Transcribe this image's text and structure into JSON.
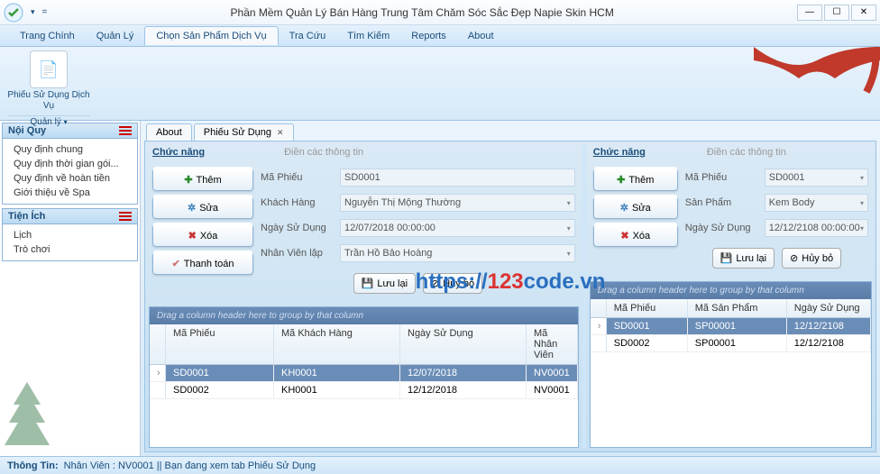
{
  "window": {
    "title": "Phần Mềm Quản Lý Bán Hàng Trung Tâm Chăm Sóc Sắc Đẹp Napie Skin HCM"
  },
  "menu": {
    "items": [
      "Trang Chính",
      "Quản Lý",
      "Chọn Sản Phẩm Dịch Vụ",
      "Tra Cứu",
      "Tìm Kiếm",
      "Reports",
      "About"
    ],
    "active_index": 2
  },
  "ribbon": {
    "button_label": "Phiếu Sử Dụng Dịch Vụ",
    "group_label": "Quản lý"
  },
  "sidebar": {
    "panel1": {
      "title": "Nội Quy",
      "items": [
        "Quy định chung",
        "Quy định thời gian gói...",
        "Quy định về hoàn tiền",
        "Giới thiệu về Spa"
      ]
    },
    "panel2": {
      "title": "Tiện Ích",
      "items": [
        "Lịch",
        "Trò chơi"
      ]
    }
  },
  "content_tabs": {
    "items": [
      {
        "label": "About",
        "closable": false
      },
      {
        "label": "Phiếu Sử Dụng",
        "closable": true
      }
    ],
    "active_index": 1
  },
  "left_panel": {
    "func_title": "Chức năng",
    "info_title": "Điền các thông tin",
    "buttons": {
      "add": "Thêm",
      "edit": "Sửa",
      "del": "Xóa",
      "pay": "Thanh toán"
    },
    "fields": {
      "maphieu": {
        "label": "Mã Phiếu",
        "value": "SD0001"
      },
      "kh": {
        "label": "Khách Hàng",
        "value": "Nguyễn Thị Mộng Thường"
      },
      "ngay": {
        "label": "Ngày Sử Dụng",
        "value": "12/07/2018 00:00:00"
      },
      "nv": {
        "label": "Nhân Viên lập",
        "value": "Trần Hồ Bảo Hoàng"
      }
    },
    "actions": {
      "save": "Lưu lại",
      "cancel": "Hủy bỏ"
    },
    "grid": {
      "group_hint": "Drag a column header here to group by that column",
      "cols": [
        "Mã Phiếu",
        "Mã Khách Hàng",
        "Ngày Sử Dụng",
        "Mã Nhân Viên"
      ],
      "rows": [
        {
          "c": [
            "SD0001",
            "KH0001",
            "12/07/2018",
            "NV0001"
          ],
          "selected": true
        },
        {
          "c": [
            "SD0002",
            "KH0001",
            "12/12/2018",
            "NV0001"
          ],
          "selected": false
        }
      ]
    }
  },
  "right_panel": {
    "func_title": "Chức năng",
    "info_title": "Điền các thông tin",
    "buttons": {
      "add": "Thêm",
      "edit": "Sửa",
      "del": "Xóa"
    },
    "fields": {
      "maphieu": {
        "label": "Mã Phiếu",
        "value": "SD0001"
      },
      "sp": {
        "label": "Sản Phẩm",
        "value": "Kem Body"
      },
      "ngay": {
        "label": "Ngày Sử Dụng",
        "value": "12/12/2108 00:00:00"
      }
    },
    "actions": {
      "save": "Lưu lại",
      "cancel": "Hủy bỏ"
    },
    "grid": {
      "group_hint": "Drag a column header here to group by that column",
      "cols": [
        "Mã Phiếu",
        "Mã Sản Phẩm",
        "Ngày Sử Dụng"
      ],
      "rows": [
        {
          "c": [
            "SD0001",
            "SP00001",
            "12/12/2108"
          ],
          "selected": true
        },
        {
          "c": [
            "SD0002",
            "SP00001",
            "12/12/2108"
          ],
          "selected": false
        }
      ]
    }
  },
  "watermark": {
    "p1": "https://",
    "p2": "123",
    "p3": "code.vn"
  },
  "status": {
    "label": "Thông Tin:",
    "text": "Nhân Viên : NV0001 || Bạn đang xem tab Phiếu Sử Dụng"
  }
}
